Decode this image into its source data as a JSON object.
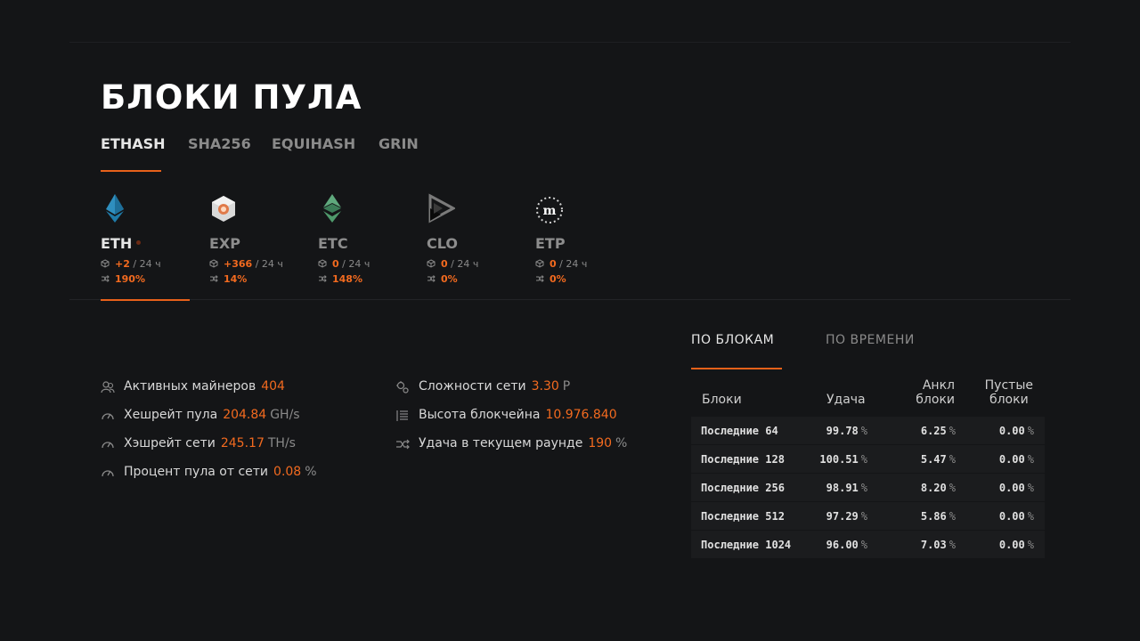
{
  "page_title": "БЛОКИ ПУЛА",
  "algo_tabs": [
    "ETHASH",
    "SHA256",
    "EQUIHASH",
    "GRIN"
  ],
  "coins": [
    {
      "name": "ETH",
      "blocks": "+2",
      "period": "/ 24 ч",
      "luck": "190%",
      "icon": "ethereum-icon",
      "active": true
    },
    {
      "name": "EXP",
      "blocks": "+366",
      "period": "/ 24 ч",
      "luck": "14%",
      "icon": "expanse-icon"
    },
    {
      "name": "ETC",
      "blocks": "0",
      "period": "/ 24 ч",
      "luck": "148%",
      "icon": "ethereum-classic-icon"
    },
    {
      "name": "CLO",
      "blocks": "0",
      "period": "/ 24 ч",
      "luck": "0%",
      "icon": "callisto-icon"
    },
    {
      "name": "ETP",
      "blocks": "0",
      "period": "/ 24 ч",
      "luck": "0%",
      "icon": "metaverse-icon"
    }
  ],
  "stats_left": [
    {
      "label": "Активных майнеров",
      "value": "404",
      "unit": "",
      "icon": "miners-icon"
    },
    {
      "label": "Хешрейт пула",
      "value": "204.84",
      "unit": "GH/s",
      "icon": "gauge-icon"
    },
    {
      "label": "Хэшрейт сети",
      "value": "245.17",
      "unit": "TH/s",
      "icon": "gauge-icon"
    },
    {
      "label": "Процент пула от сети",
      "value": "0.08",
      "unit": "%",
      "icon": "gauge-icon"
    }
  ],
  "stats_right": [
    {
      "label": "Сложности сети",
      "value": "3.30",
      "unit": "P",
      "icon": "difficulty-icon"
    },
    {
      "label": "Высота блокчейна",
      "value": "10.976.840",
      "unit": "",
      "icon": "list-icon"
    },
    {
      "label": "Удача в текущем раунде",
      "value": "190",
      "unit": "%",
      "icon": "shuffle-icon"
    }
  ],
  "luck_tabs": [
    "ПО БЛОКАМ",
    "ПО ВРЕМЕНИ"
  ],
  "luck_table": {
    "headers": {
      "blocks": "Блоки",
      "luck": "Удача",
      "uncle_1": "Анкл",
      "uncle_2": "блоки",
      "empty_1": "Пустые",
      "empty_2": "блоки"
    },
    "rows": [
      {
        "label": "Последние 64",
        "luck": "99.78",
        "uncle": "6.25",
        "empty": "0.00"
      },
      {
        "label": "Последние 128",
        "luck": "100.51",
        "uncle": "5.47",
        "empty": "0.00"
      },
      {
        "label": "Последние 256",
        "luck": "98.91",
        "uncle": "8.20",
        "empty": "0.00"
      },
      {
        "label": "Последние 512",
        "luck": "97.29",
        "uncle": "5.86",
        "empty": "0.00"
      },
      {
        "label": "Последние 1024",
        "luck": "96.00",
        "uncle": "7.03",
        "empty": "0.00"
      }
    ],
    "percent_sign": "%"
  },
  "colors": {
    "accent": "#f26a1f",
    "background": "#141517"
  }
}
